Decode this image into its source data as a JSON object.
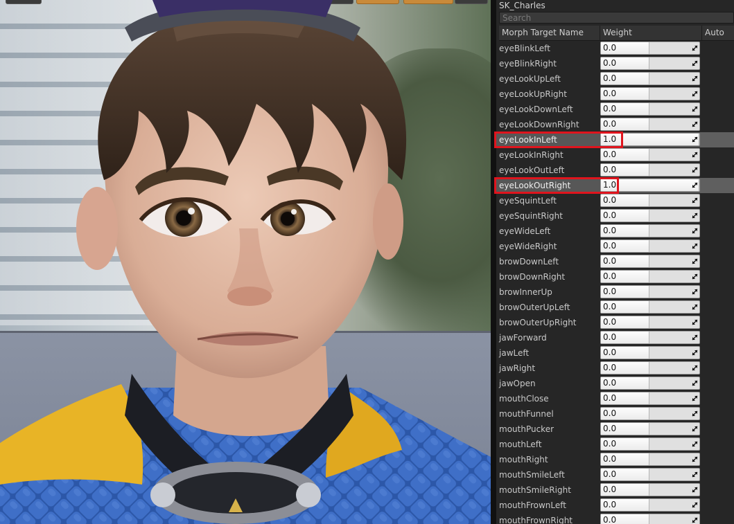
{
  "panel": {
    "asset_name": "SK_Charles",
    "search_placeholder": "Search",
    "columns": {
      "name": "Morph Target Name",
      "weight": "Weight",
      "auto": "Auto"
    },
    "highlight_color": "#e0141d",
    "rows": [
      {
        "name": "eyeBlinkLeft",
        "weight": "0.0",
        "value": 0.0,
        "active": false
      },
      {
        "name": "eyeBlinkRight",
        "weight": "0.0",
        "value": 0.0,
        "active": false
      },
      {
        "name": "eyeLookUpLeft",
        "weight": "0.0",
        "value": 0.0,
        "active": false
      },
      {
        "name": "eyeLookUpRight",
        "weight": "0.0",
        "value": 0.0,
        "active": false
      },
      {
        "name": "eyeLookDownLeft",
        "weight": "0.0",
        "value": 0.0,
        "active": false
      },
      {
        "name": "eyeLookDownRight",
        "weight": "0.0",
        "value": 0.0,
        "active": false
      },
      {
        "name": "eyeLookInLeft",
        "weight": "1.0",
        "value": 1.0,
        "active": true
      },
      {
        "name": "eyeLookInRight",
        "weight": "0.0",
        "value": 0.0,
        "active": false
      },
      {
        "name": "eyeLookOutLeft",
        "weight": "0.0",
        "value": 0.0,
        "active": false
      },
      {
        "name": "eyeLookOutRight",
        "weight": "1.0",
        "value": 1.0,
        "active": true
      },
      {
        "name": "eyeSquintLeft",
        "weight": "0.0",
        "value": 0.0,
        "active": false
      },
      {
        "name": "eyeSquintRight",
        "weight": "0.0",
        "value": 0.0,
        "active": false
      },
      {
        "name": "eyeWideLeft",
        "weight": "0.0",
        "value": 0.0,
        "active": false
      },
      {
        "name": "eyeWideRight",
        "weight": "0.0",
        "value": 0.0,
        "active": false
      },
      {
        "name": "browDownLeft",
        "weight": "0.0",
        "value": 0.0,
        "active": false
      },
      {
        "name": "browDownRight",
        "weight": "0.0",
        "value": 0.0,
        "active": false
      },
      {
        "name": "browInnerUp",
        "weight": "0.0",
        "value": 0.0,
        "active": false
      },
      {
        "name": "browOuterUpLeft",
        "weight": "0.0",
        "value": 0.0,
        "active": false
      },
      {
        "name": "browOuterUpRight",
        "weight": "0.0",
        "value": 0.0,
        "active": false
      },
      {
        "name": "jawForward",
        "weight": "0.0",
        "value": 0.0,
        "active": false
      },
      {
        "name": "jawLeft",
        "weight": "0.0",
        "value": 0.0,
        "active": false
      },
      {
        "name": "jawRight",
        "weight": "0.0",
        "value": 0.0,
        "active": false
      },
      {
        "name": "jawOpen",
        "weight": "0.0",
        "value": 0.0,
        "active": false
      },
      {
        "name": "mouthClose",
        "weight": "0.0",
        "value": 0.0,
        "active": false
      },
      {
        "name": "mouthFunnel",
        "weight": "0.0",
        "value": 0.0,
        "active": false
      },
      {
        "name": "mouthPucker",
        "weight": "0.0",
        "value": 0.0,
        "active": false
      },
      {
        "name": "mouthLeft",
        "weight": "0.0",
        "value": 0.0,
        "active": false
      },
      {
        "name": "mouthRight",
        "weight": "0.0",
        "value": 0.0,
        "active": false
      },
      {
        "name": "mouthSmileLeft",
        "weight": "0.0",
        "value": 0.0,
        "active": false
      },
      {
        "name": "mouthSmileRight",
        "weight": "0.0",
        "value": 0.0,
        "active": false
      },
      {
        "name": "mouthFrownLeft",
        "weight": "0.0",
        "value": 0.0,
        "active": false
      },
      {
        "name": "mouthFrownRight",
        "weight": "0.0",
        "value": 0.0,
        "active": false
      }
    ]
  }
}
